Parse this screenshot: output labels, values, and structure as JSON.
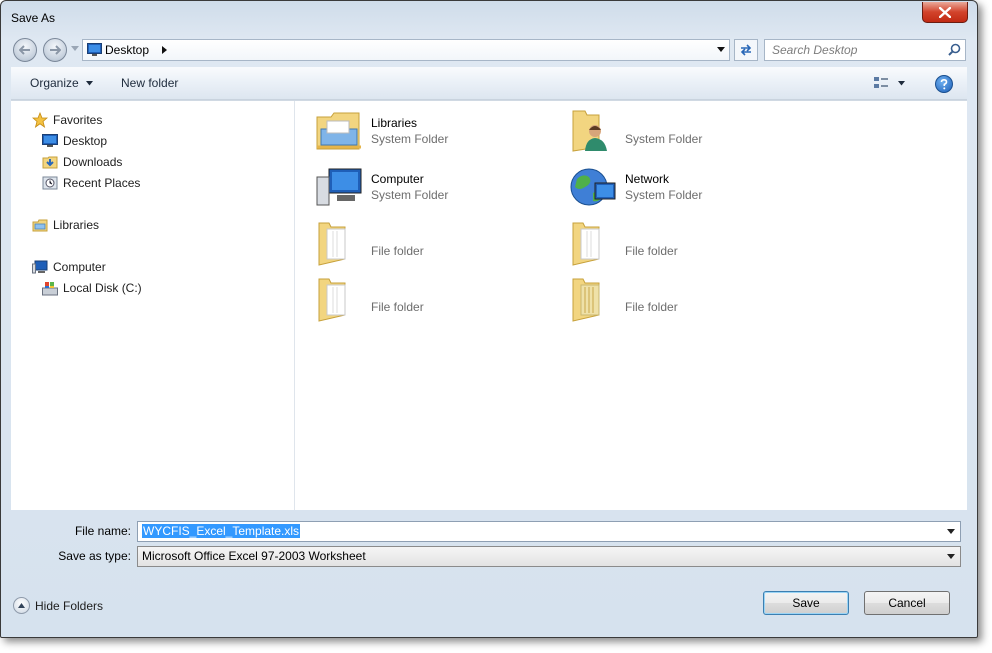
{
  "window": {
    "title": "Save As"
  },
  "address": {
    "location": "Desktop"
  },
  "search": {
    "placeholder": "Search Desktop"
  },
  "toolbar": {
    "organize_label": "Organize",
    "new_folder_label": "New folder"
  },
  "nav_pane": {
    "favorites_label": "Favorites",
    "favorites": [
      {
        "label": "Desktop",
        "icon": "desktop-icon"
      },
      {
        "label": "Downloads",
        "icon": "downloads-icon"
      },
      {
        "label": "Recent Places",
        "icon": "recent-places-icon"
      }
    ],
    "libraries_label": "Libraries",
    "computer_label": "Computer",
    "computer_children": [
      {
        "label": "Local Disk (C:)",
        "icon": "local-disk-icon"
      }
    ]
  },
  "files": [
    {
      "name": "Libraries",
      "type": "System Folder",
      "icon": "libraries-folder-icon"
    },
    {
      "name": "",
      "type": "System Folder",
      "icon": "user-folder-icon"
    },
    {
      "name": "Computer",
      "type": "System Folder",
      "icon": "computer-icon"
    },
    {
      "name": "Network",
      "type": "System Folder",
      "icon": "network-icon"
    },
    {
      "name": "",
      "type": "File folder",
      "icon": "folder-icon"
    },
    {
      "name": "",
      "type": "File folder",
      "icon": "folder-icon"
    },
    {
      "name": "",
      "type": "File folder",
      "icon": "folder-icon"
    },
    {
      "name": "",
      "type": "File folder",
      "icon": "folder-icon"
    }
  ],
  "form": {
    "file_name_label": "File name:",
    "file_name_value": "WYCFIS_Excel_Template.xls",
    "save_type_label": "Save as type:",
    "save_type_value": "Microsoft Office Excel 97-2003 Worksheet"
  },
  "footer": {
    "hide_folders_label": "Hide Folders",
    "save_label": "Save",
    "cancel_label": "Cancel"
  },
  "colors": {
    "selection": "#3399ff",
    "folder": "#f2d580",
    "close": "#c7402a"
  }
}
